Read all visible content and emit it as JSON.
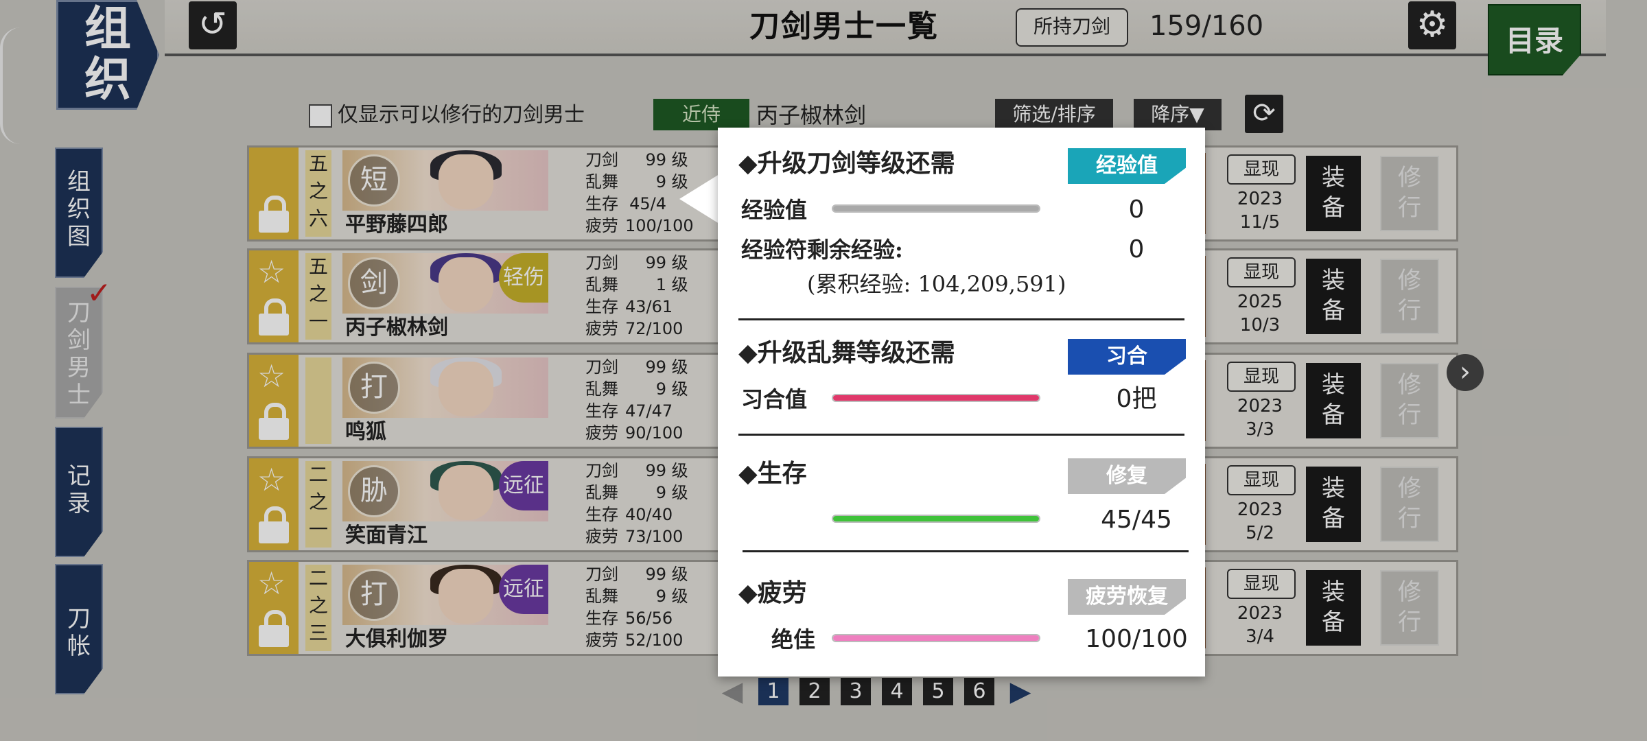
{
  "header": {
    "org_tab": [
      "组",
      "织"
    ],
    "back_icon": "back-arrow-icon",
    "title": "刀剑男士一覧",
    "owned_label": "所持刀剑",
    "owned_count": "159/160",
    "settings_icon": "gear-icon",
    "menu_label": "目录"
  },
  "sidebar": {
    "items": [
      {
        "label": [
          "组",
          "织",
          "图"
        ],
        "active": true
      },
      {
        "label": [
          "刀",
          "剑",
          "男",
          "士"
        ],
        "active": false
      },
      {
        "label": [
          "记",
          "录"
        ],
        "active": true
      },
      {
        "label": [
          "刀",
          "帐"
        ],
        "active": true
      }
    ]
  },
  "filters": {
    "checkbox_label": "仅显示可以修行的刀剑男士",
    "attendant_tag": "近侍",
    "attendant_name": "丙子椒林剑",
    "filter_sort": "筛选/排序",
    "order": "降序▼"
  },
  "stat_labels": {
    "sword": "刀剑",
    "dance": "乱舞",
    "survival": "生存",
    "fatigue": "疲劳",
    "level_unit": "级"
  },
  "rows": [
    {
      "rank": [
        "五",
        "之",
        "六"
      ],
      "type": "短",
      "name": "平野藤四郎",
      "sword_lv": "99",
      "dance_lv": "9",
      "survival": "45/4",
      "fatigue": "100/100",
      "display": "显现",
      "date": [
        "2023",
        "11/5"
      ],
      "equip": [
        "装",
        "备"
      ],
      "train": [
        "修",
        "行"
      ],
      "starred": false,
      "badge": ""
    },
    {
      "rank": [
        "五",
        "之",
        "一"
      ],
      "type": "剑",
      "name": "丙子椒林剑",
      "sword_lv": "99",
      "dance_lv": "1",
      "survival": "43/61",
      "fatigue": "72/100",
      "display": "显现",
      "date": [
        "2025",
        "10/3"
      ],
      "equip": [
        "装",
        "备"
      ],
      "train": [
        "修",
        "行"
      ],
      "starred": true,
      "badge": "轻伤"
    },
    {
      "rank": [
        "",
        "",
        ""
      ],
      "type": "打",
      "name": "鸣狐",
      "sword_lv": "99",
      "dance_lv": "9",
      "survival": "47/47",
      "fatigue": "90/100",
      "display": "显现",
      "date": [
        "2023",
        "3/3"
      ],
      "equip": [
        "装",
        "备"
      ],
      "train": [
        "修",
        "行"
      ],
      "starred": true,
      "badge": ""
    },
    {
      "rank": [
        "二",
        "之",
        "一"
      ],
      "type": "胁",
      "name": "笑面青江",
      "sword_lv": "99",
      "dance_lv": "9",
      "survival": "40/40",
      "fatigue": "73/100",
      "display": "显现",
      "date": [
        "2023",
        "5/2"
      ],
      "equip": [
        "装",
        "备"
      ],
      "train": [
        "修",
        "行"
      ],
      "starred": true,
      "badge": "远征"
    },
    {
      "rank": [
        "二",
        "之",
        "三"
      ],
      "type": "打",
      "name": "大俱利伽罗",
      "sword_lv": "99",
      "dance_lv": "9",
      "survival": "56/56",
      "fatigue": "52/100",
      "display": "显现",
      "date": [
        "2023",
        "3/4"
      ],
      "equip": [
        "装",
        "备"
      ],
      "train": [
        "修",
        "行"
      ],
      "starred": true,
      "badge": "远征"
    }
  ],
  "pagination": {
    "pages": [
      "1",
      "2",
      "3",
      "4",
      "5",
      "6"
    ],
    "current": "1"
  },
  "popup": {
    "level_up_heading": "◆升级刀剑等级还需",
    "exp_button": "经验值",
    "exp_label": "经验值",
    "exp_value": "0",
    "exp_remaining_label": "经验符剩余经验:",
    "exp_remaining_value": "0",
    "exp_total": "(累积经验: 104,209,591)",
    "dance_heading": "◆升级乱舞等级还需",
    "dance_button": "习合",
    "dance_label": "习合值",
    "dance_value": "0把",
    "survival_heading": "◆生存",
    "repair_button": "修复",
    "survival_value": "45/45",
    "survival_fraction": 1.0,
    "fatigue_heading": "◆疲劳",
    "fatigue_button": "疲劳恢复",
    "fatigue_label": "绝佳",
    "fatigue_value": "100/100",
    "fatigue_fraction": 1.0,
    "exp_fraction": 1.0,
    "dance_fraction": 1.0
  },
  "colors": {
    "navy": "#1d3358",
    "green": "#1e5a24",
    "gold": "#d9b33a",
    "exp_button": "#1aa5b8",
    "dance_button": "#1a4fb0",
    "gray_button": "#b9b9b9",
    "exp_bar": "#a9a9a9",
    "dance_bar": "#e0386a",
    "survival_bar": "#3fc23a",
    "fatigue_bar": "#ee7fbf"
  }
}
